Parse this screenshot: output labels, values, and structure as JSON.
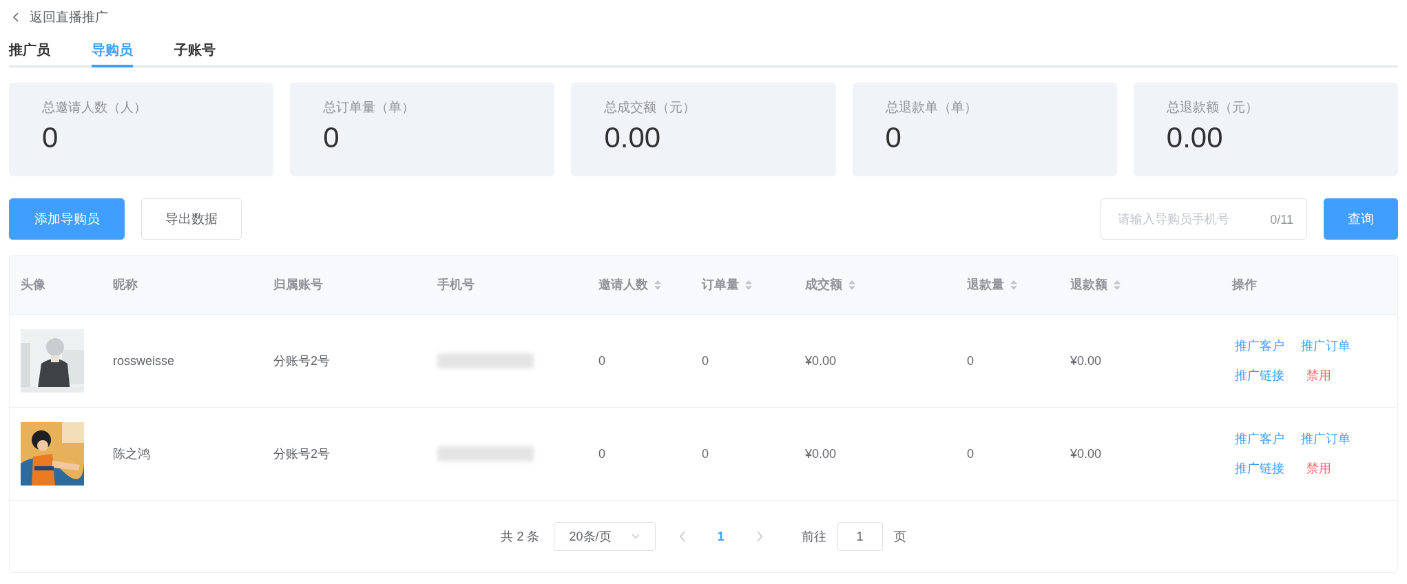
{
  "back_link": "返回直播推广",
  "tabs": [
    {
      "label": "推广员",
      "selected": false
    },
    {
      "label": "导购员",
      "selected": true
    },
    {
      "label": "子账号",
      "selected": false
    }
  ],
  "stats": [
    {
      "label": "总邀请人数（人）",
      "value": "0"
    },
    {
      "label": "总订单量（单）",
      "value": "0"
    },
    {
      "label": "总成交额（元）",
      "value": "0.00"
    },
    {
      "label": "总退款单（单）",
      "value": "0"
    },
    {
      "label": "总退款额（元）",
      "value": "0.00"
    }
  ],
  "actions": [
    {
      "label": "添加导购员",
      "kind": "primary"
    },
    {
      "label": "导出数据",
      "kind": "default"
    }
  ],
  "search": {
    "placeholder": "请输入导购员手机号",
    "counter": "0/11"
  },
  "query_button": "查询",
  "table": {
    "columns": [
      {
        "label": "头像",
        "sortable": false
      },
      {
        "label": "昵称",
        "sortable": false
      },
      {
        "label": "归属账号",
        "sortable": false
      },
      {
        "label": "手机号",
        "sortable": false
      },
      {
        "label": "邀请人数",
        "sortable": true
      },
      {
        "label": "订单量",
        "sortable": true
      },
      {
        "label": "成交额",
        "sortable": true
      },
      {
        "label": "退款量",
        "sortable": true
      },
      {
        "label": "退款额",
        "sortable": true
      },
      {
        "label": "操作",
        "sortable": false
      }
    ],
    "rows": [
      {
        "nickname": "rossweisse",
        "account": "分账号2号",
        "invites": "0",
        "orders": "0",
        "amount": "¥0.00",
        "refunds": "0",
        "refund_amount": "¥0.00",
        "operations": [
          {
            "label": "推广客户",
            "kind": "link"
          },
          {
            "label": "推广订单",
            "kind": "link"
          },
          {
            "label": "推广链接",
            "kind": "link"
          },
          {
            "label": "禁用",
            "kind": "danger"
          }
        ]
      },
      {
        "nickname": "陈之鸿",
        "account": "分账号2号",
        "invites": "0",
        "orders": "0",
        "amount": "¥0.00",
        "refunds": "0",
        "refund_amount": "¥0.00",
        "operations": [
          {
            "label": "推广客户",
            "kind": "link"
          },
          {
            "label": "推广订单",
            "kind": "link"
          },
          {
            "label": "推广链接",
            "kind": "link"
          },
          {
            "label": "禁用",
            "kind": "danger"
          }
        ]
      }
    ]
  },
  "pagination": {
    "total": "共 2 条",
    "page_size": "20条/页",
    "pages": [
      {
        "label": "1",
        "selected": true
      }
    ],
    "goto_label": "前往",
    "goto_value": "1",
    "goto_suffix": "页"
  }
}
